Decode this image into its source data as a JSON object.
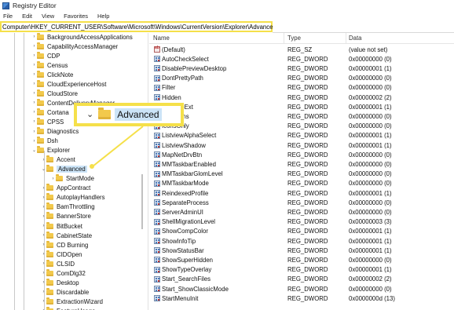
{
  "window": {
    "title": "Registry Editor"
  },
  "menu": [
    "File",
    "Edit",
    "View",
    "Favorites",
    "Help"
  ],
  "address": "Computer\\HKEY_CURRENT_USER\\Software\\Microsoft\\Windows\\CurrentVersion\\Explorer\\Advanced",
  "tree": {
    "items": [
      {
        "label": "BackgroundAccessApplications",
        "expanded": false
      },
      {
        "label": "CapabilityAccessManager",
        "expanded": false
      },
      {
        "label": "CDP",
        "expanded": false
      },
      {
        "label": "Census",
        "expanded": false
      },
      {
        "label": "ClickNote",
        "expanded": false
      },
      {
        "label": "CloudExperienceHost",
        "expanded": false
      },
      {
        "label": "CloudStore",
        "expanded": false
      },
      {
        "label": "ContentDeliveryManager",
        "expanded": false
      },
      {
        "label": "Cortana",
        "expanded": false
      },
      {
        "label": "CPSS",
        "expanded": false
      },
      {
        "label": "Diagnostics",
        "expanded": false
      },
      {
        "label": "Dsh",
        "expanded": false
      },
      {
        "label": "Explorer",
        "expanded": true
      },
      {
        "label": "Accent",
        "expanded": false
      },
      {
        "label": "Advanced",
        "expanded": true,
        "selected": true
      },
      {
        "label": "StartMode",
        "expanded": false
      },
      {
        "label": "AppContract",
        "expanded": false
      },
      {
        "label": "AutoplayHandlers",
        "expanded": false
      },
      {
        "label": "BamThrottling",
        "expanded": false
      },
      {
        "label": "BannerStore",
        "expanded": false
      },
      {
        "label": "BitBucket",
        "expanded": false
      },
      {
        "label": "CabinetState",
        "expanded": false
      },
      {
        "label": "CD Burning",
        "expanded": false
      },
      {
        "label": "CIDOpen",
        "expanded": false
      },
      {
        "label": "CLSID",
        "expanded": false
      },
      {
        "label": "ComDlg32",
        "expanded": false
      },
      {
        "label": "Desktop",
        "expanded": false
      },
      {
        "label": "Discardable",
        "expanded": false
      },
      {
        "label": "ExtractionWizard",
        "expanded": false
      },
      {
        "label": "FeatureUsage",
        "expanded": false
      }
    ]
  },
  "list": {
    "columns": [
      "Name",
      "Type",
      "Data"
    ],
    "rows": [
      {
        "name": "(Default)",
        "type": "REG_SZ",
        "data": "(value not set)",
        "icon": "string-value-icon"
      },
      {
        "name": "AutoCheckSelect",
        "type": "REG_DWORD",
        "data": "0x00000000 (0)",
        "icon": "dword-value-icon"
      },
      {
        "name": "DisablePreviewDesktop",
        "type": "REG_DWORD",
        "data": "0x00000001 (1)",
        "icon": "dword-value-icon"
      },
      {
        "name": "DontPrettyPath",
        "type": "REG_DWORD",
        "data": "0x00000000 (0)",
        "icon": "dword-value-icon"
      },
      {
        "name": "Filter",
        "type": "REG_DWORD",
        "data": "0x00000000 (0)",
        "icon": "dword-value-icon"
      },
      {
        "name": "Hidden",
        "type": "REG_DWORD",
        "data": "0x00000002 (2)",
        "icon": "dword-value-icon"
      },
      {
        "name": "HideFileExt",
        "type": "REG_DWORD",
        "data": "0x00000001 (1)",
        "icon": "dword-value-icon"
      },
      {
        "name": "HideIcons",
        "type": "REG_DWORD",
        "data": "0x00000000 (0)",
        "icon": "dword-value-icon"
      },
      {
        "name": "IconsOnly",
        "type": "REG_DWORD",
        "data": "0x00000000 (0)",
        "icon": "dword-value-icon"
      },
      {
        "name": "ListviewAlphaSelect",
        "type": "REG_DWORD",
        "data": "0x00000001 (1)",
        "icon": "dword-value-icon"
      },
      {
        "name": "ListviewShadow",
        "type": "REG_DWORD",
        "data": "0x00000001 (1)",
        "icon": "dword-value-icon"
      },
      {
        "name": "MapNetDrvBtn",
        "type": "REG_DWORD",
        "data": "0x00000000 (0)",
        "icon": "dword-value-icon"
      },
      {
        "name": "MMTaskbarEnabled",
        "type": "REG_DWORD",
        "data": "0x00000000 (0)",
        "icon": "dword-value-icon"
      },
      {
        "name": "MMTaskbarGlomLevel",
        "type": "REG_DWORD",
        "data": "0x00000000 (0)",
        "icon": "dword-value-icon"
      },
      {
        "name": "MMTaskbarMode",
        "type": "REG_DWORD",
        "data": "0x00000000 (0)",
        "icon": "dword-value-icon"
      },
      {
        "name": "ReindexedProfile",
        "type": "REG_DWORD",
        "data": "0x00000001 (1)",
        "icon": "dword-value-icon"
      },
      {
        "name": "SeparateProcess",
        "type": "REG_DWORD",
        "data": "0x00000000 (0)",
        "icon": "dword-value-icon"
      },
      {
        "name": "ServerAdminUI",
        "type": "REG_DWORD",
        "data": "0x00000000 (0)",
        "icon": "dword-value-icon"
      },
      {
        "name": "ShellMigrationLevel",
        "type": "REG_DWORD",
        "data": "0x00000003 (3)",
        "icon": "dword-value-icon"
      },
      {
        "name": "ShowCompColor",
        "type": "REG_DWORD",
        "data": "0x00000001 (1)",
        "icon": "dword-value-icon"
      },
      {
        "name": "ShowInfoTip",
        "type": "REG_DWORD",
        "data": "0x00000001 (1)",
        "icon": "dword-value-icon"
      },
      {
        "name": "ShowStatusBar",
        "type": "REG_DWORD",
        "data": "0x00000001 (1)",
        "icon": "dword-value-icon"
      },
      {
        "name": "ShowSuperHidden",
        "type": "REG_DWORD",
        "data": "0x00000000 (0)",
        "icon": "dword-value-icon"
      },
      {
        "name": "ShowTypeOverlay",
        "type": "REG_DWORD",
        "data": "0x00000001 (1)",
        "icon": "dword-value-icon"
      },
      {
        "name": "Start_SearchFiles",
        "type": "REG_DWORD",
        "data": "0x00000002 (2)",
        "icon": "dword-value-icon"
      },
      {
        "name": "Start_ShowClassicMode",
        "type": "REG_DWORD",
        "data": "0x00000000 (0)",
        "icon": "dword-value-icon"
      },
      {
        "name": "StartMenuInit",
        "type": "REG_DWORD",
        "data": "0x0000000d (13)",
        "icon": "dword-value-icon"
      }
    ]
  },
  "callout": {
    "label": "Advanced"
  },
  "colors": {
    "highlight": "#f5e04a",
    "selection": "#cce4f7",
    "folder": "#f2c94c"
  }
}
